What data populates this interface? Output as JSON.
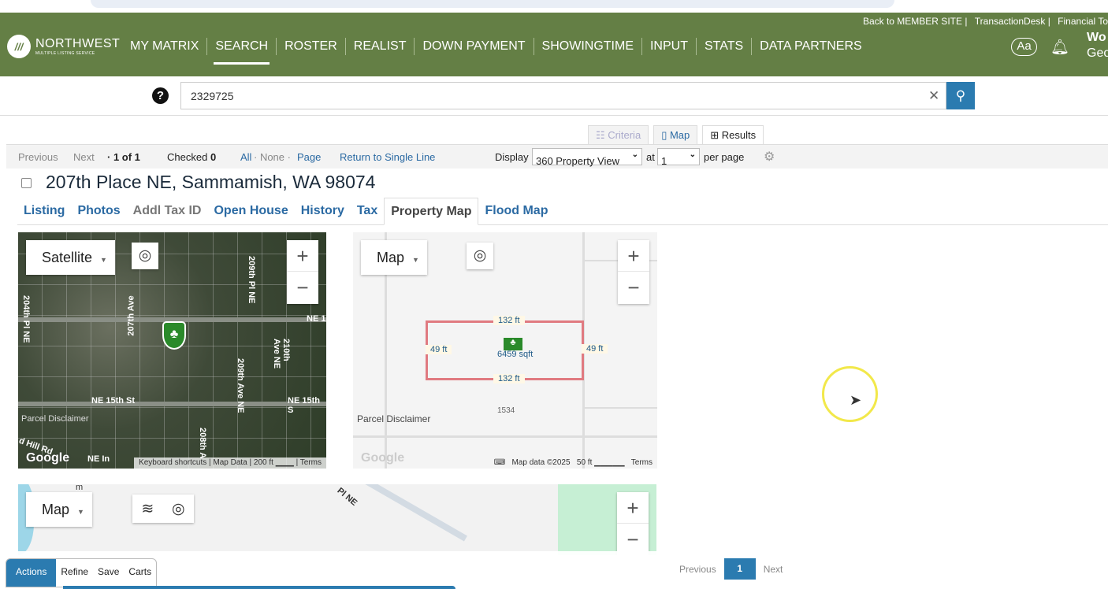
{
  "header": {
    "logo": {
      "name": "NORTHWEST",
      "tagline": "MULTIPLE LISTING SERVICE"
    },
    "top_links": [
      "Back to MEMBER SITE |",
      "TransactionDesk |",
      "Financial To"
    ],
    "nav": [
      "MY MATRIX",
      "SEARCH",
      "ROSTER",
      "REALIST",
      "DOWN PAYMENT",
      "SHOWINGTIME",
      "INPUT",
      "STATS",
      "DATA PARTNERS"
    ],
    "active_nav": "SEARCH",
    "font_size_button": "Aa",
    "user_line1": "Wo",
    "user_line2": "Geo",
    "brand_color": "#647f45"
  },
  "search": {
    "help": "?",
    "value": "2329725",
    "clear": "✕",
    "button_icon": "search-icon"
  },
  "view_tabs": [
    {
      "label": "Criteria",
      "icon": "☷"
    },
    {
      "label": "Map",
      "icon": "▯"
    },
    {
      "label": "Results",
      "icon": "⊞"
    }
  ],
  "toolbar": {
    "previous": "Previous",
    "next": "Next",
    "count": "· 1 of 1",
    "checked_label": "Checked",
    "checked_count": "0",
    "all": "All",
    "none": "· None ·",
    "page": "Page",
    "return": "Return to Single Line",
    "display_label": "Display",
    "display_value": "360 Property View",
    "at_label": "at",
    "per_page_value": "1",
    "per_page_label": "per page"
  },
  "listing": {
    "title": "207th Place NE, Sammamish, WA 98074"
  },
  "sub_tabs": [
    "Listing",
    "Photos",
    "Addl Tax ID",
    "Open House",
    "History",
    "Tax",
    "Property Map",
    "Flood Map"
  ],
  "active_sub_tab": "Property Map",
  "map1": {
    "type": "Satellite",
    "labels": [
      "204th Pl NE",
      "207th Ave",
      "209th Pl NE",
      "NE 1",
      "210th Ave NE",
      "209th Ave NE",
      "NE 15th St",
      "NE 15th S",
      "Parcel Disclaimer",
      "208th A",
      "d Hill Rd",
      "NE In"
    ],
    "logo": "Google",
    "footer": [
      "Keyboard shortcuts",
      "Map Data",
      "200 ft",
      "Terms"
    ]
  },
  "map2": {
    "type": "Map",
    "edges": [
      "132 ft",
      "49 ft",
      "49 ft",
      "132 ft"
    ],
    "area": "6459 sqft",
    "parcel_number": "1534",
    "disclaimer": "Parcel Disclaimer",
    "logo": "Google",
    "footer": [
      "Map data ©2025",
      "50 ft",
      "Terms"
    ]
  },
  "map3": {
    "type": "Map",
    "labels": [
      "m",
      "Pl NE"
    ]
  },
  "zoom": {
    "in": "+",
    "out": "−"
  },
  "bottom": {
    "tabs": [
      "Actions",
      "Refine",
      "Save",
      "Carts"
    ],
    "pager": {
      "previous": "Previous",
      "page": "1",
      "next": "Next"
    }
  }
}
